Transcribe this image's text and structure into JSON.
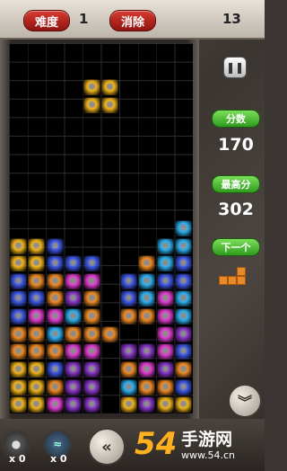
{
  "header": {
    "difficulty_label": "难度",
    "difficulty_value": "1",
    "cleared_label": "消除",
    "cleared_value": "13"
  },
  "side": {
    "score_label": "分数",
    "score_value": "170",
    "best_label": "最高分",
    "best_value": "302",
    "next_label": "下一个"
  },
  "bottom": {
    "item1_count": "x 0",
    "item2_count": "x 0"
  },
  "watermark": {
    "text_main": "手游网",
    "text_sub": "www.54.cn",
    "logo": "54"
  },
  "icons": [
    "pause-icon",
    "double-chevron-down-icon",
    "double-chevron-left-icon",
    "bomb-icon",
    "wave-icon"
  ],
  "colors": {
    "Y": "#f2b51c",
    "O": "#f08a25",
    "B": "#3e58e8",
    "C": "#2db0ef",
    "M": "#e23dd2",
    "P": "#8a36c9",
    "R": "#e64a4a"
  },
  "board": {
    "rows": 20,
    "cols": 10,
    "cells": [
      "..........",
      "..........",
      "....YY....",
      "....YY....",
      "..........",
      "..........",
      "..........",
      "..........",
      "..........",
      "..........",
      ".........C",
      "YYB.....CC",
      "YYBBB..OCB",
      "BOOMM.BCBB",
      "BBOPO.BCMC",
      "BMMCO.OOMC",
      "OOCOOO..MP",
      "OOOMM.PPMB",
      "YYBPP.OMPO",
      "YYOPP.COOB",
      "YYMPP.YPYY"
    ]
  }
}
